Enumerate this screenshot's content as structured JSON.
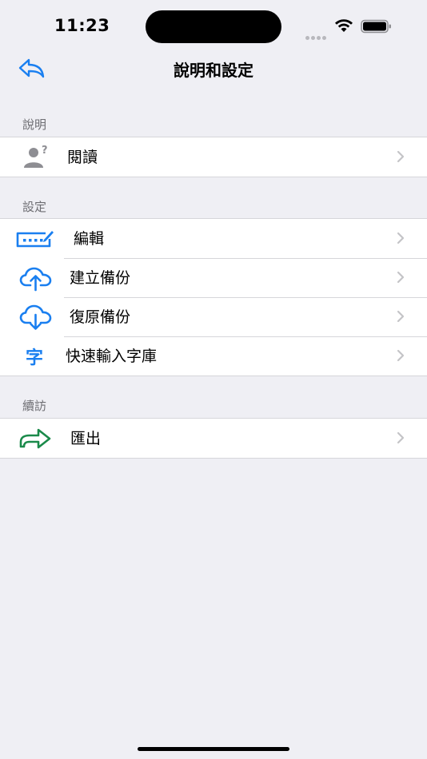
{
  "status_bar": {
    "time": "11:23"
  },
  "nav": {
    "title": "說明和設定",
    "back_icon": "back-arrow-icon"
  },
  "sections": [
    {
      "header": "說明",
      "items": [
        {
          "label": "閱讀",
          "icon": "person-question-icon"
        }
      ]
    },
    {
      "header": "設定",
      "items": [
        {
          "label": "編輯",
          "icon": "keyboard-pencil-icon"
        },
        {
          "label": "建立備份",
          "icon": "cloud-upload-icon"
        },
        {
          "label": "復原備份",
          "icon": "cloud-download-icon"
        },
        {
          "label": "快速輸入字庫",
          "icon": "character-icon",
          "icon_text": "字"
        }
      ]
    },
    {
      "header": "續訪",
      "items": [
        {
          "label": "匯出",
          "icon": "export-arrow-icon"
        }
      ]
    }
  ],
  "colors": {
    "accent": "#1a7ff0",
    "export": "#1a8a4a",
    "background": "#efeff4"
  }
}
